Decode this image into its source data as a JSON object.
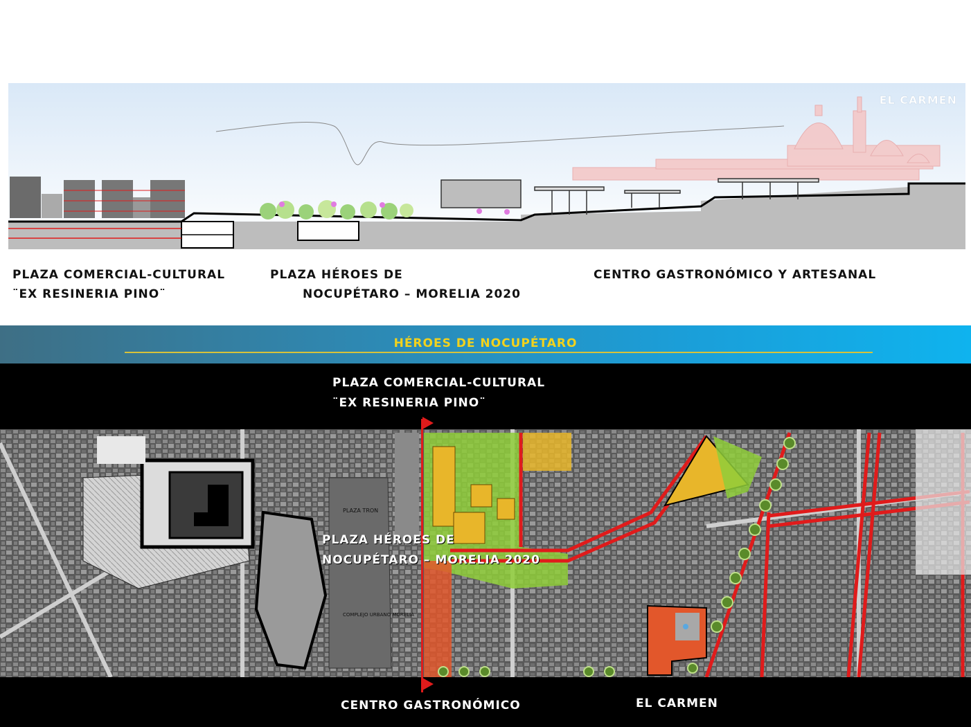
{
  "section": {
    "corner_label": "EL CARMEN",
    "label_left_line1": "PLAZA COMERCIAL-CULTURAL",
    "label_left_line2": "¨EX RESINERIA PINO¨",
    "label_mid_line1": "PLAZA HÉROES DE",
    "label_mid_line2": "NOCUPÉTARO – MORELIA 2020",
    "label_right": "CENTRO GASTRONÓMICO Y ARTESANAL"
  },
  "banner": {
    "title": "HÉROES DE NOCUPÉTARO"
  },
  "map": {
    "label_top_line1": "PLAZA COMERCIAL-CULTURAL",
    "label_top_line2": "¨EX RESINERIA PINO¨",
    "label_center_line1": "PLAZA HÉROES DE",
    "label_center_line2": "NOCUPÉTARO – MORELIA 2020",
    "label_bottom_left": "CENTRO GASTRONÓMICO",
    "label_bottom_right": "EL CARMEN",
    "block_label_plaza_tron": "PLAZA TRON",
    "block_label_complejo": "COMPLEJO URBANO MORELIA"
  },
  "colors": {
    "sky_top": "#e9f2fb",
    "ground": "#bdbdbd",
    "church": "#f4c8c8",
    "banner_text": "#f2d21d",
    "route_red": "#e01b1b",
    "green_zone": "#8fce3a",
    "building_yellow": "#e8b62a",
    "carmen_orange": "#e2572b"
  }
}
